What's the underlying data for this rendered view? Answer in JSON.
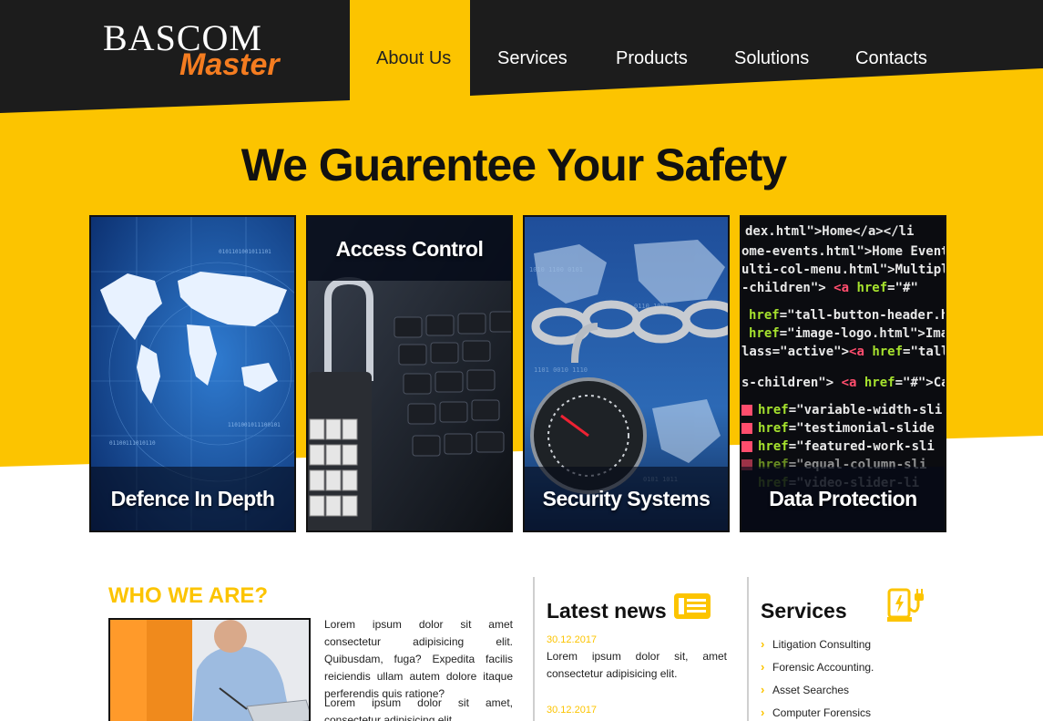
{
  "header": {
    "logo_top": "BASCOM",
    "logo_bottom": "Master",
    "nav": [
      {
        "label": "About Us",
        "active": true
      },
      {
        "label": "Services",
        "active": false
      },
      {
        "label": "Products",
        "active": false
      },
      {
        "label": "Solutions",
        "active": false
      },
      {
        "label": "Contacts",
        "active": false
      }
    ]
  },
  "hero": {
    "title": "We Guarentee Your Safety"
  },
  "cards": [
    {
      "label": "Defence In Depth",
      "icon": "world-map-image"
    },
    {
      "label": "Access Control",
      "icon": "padlock-keyboard-image"
    },
    {
      "label": "Security Systems",
      "icon": "chain-lock-map-image"
    },
    {
      "label": "Data Protection",
      "icon": "code-screen-image"
    }
  ],
  "who": {
    "title": "WHO WE ARE?",
    "paragraphs": [
      "Lorem ipsum dolor sit amet consectetur adipisicing elit. Quibusdam, fuga? Expedita facilis reiciendis ullam autem dolore itaque perferendis quis ratione?",
      "Lorem ipsum dolor sit amet, consectetur adipisicing elit."
    ]
  },
  "news": {
    "title": "Latest news",
    "icon": "newspaper-icon",
    "items": [
      {
        "date": "30.12.2017",
        "text": "Lorem ipsum dolor sit, amet consectetur adipisicing elit."
      },
      {
        "date": "30.12.2017",
        "text": ""
      }
    ]
  },
  "services": {
    "title": "Services",
    "icon": "charging-station-icon",
    "items": [
      "Litigation Consulting",
      "Forensic Accounting.",
      "Asset Searches",
      "Computer Forensics"
    ]
  },
  "colors": {
    "accent": "#fcc400",
    "dark": "#1c1c1c",
    "logo_orange": "#f47c20"
  }
}
